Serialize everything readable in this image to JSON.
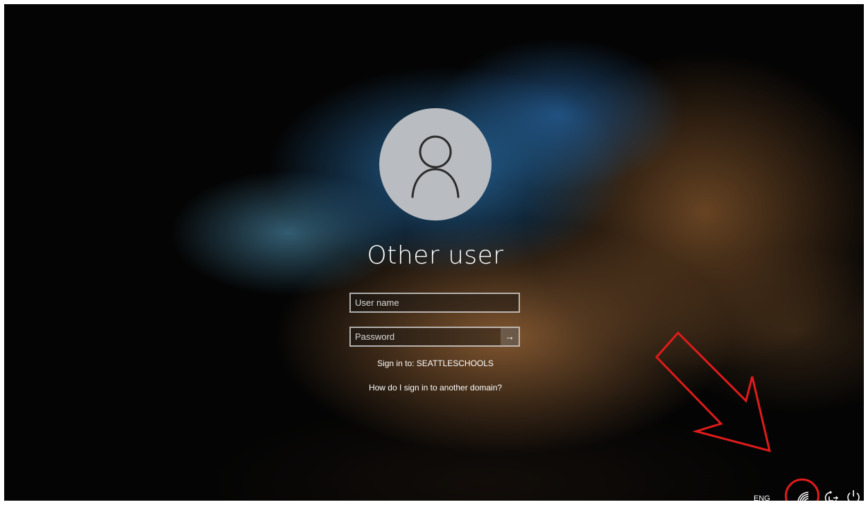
{
  "login": {
    "account_name": "Other user",
    "username_placeholder": "User name",
    "password_placeholder": "Password",
    "submit_glyph": "→",
    "sign_in_to": "Sign in to: SEATTLESCHOOLS",
    "help_link": "How do I sign in to another domain?",
    "avatar_icon": "user-silhouette-icon"
  },
  "tray": {
    "language": "ENG",
    "icons": [
      "network-icon",
      "ease-of-access-icon",
      "power-icon"
    ]
  },
  "annotation": {
    "color": "#e11b1b",
    "shapes": [
      "arrow pointing to network icon",
      "circle around network icon"
    ]
  }
}
